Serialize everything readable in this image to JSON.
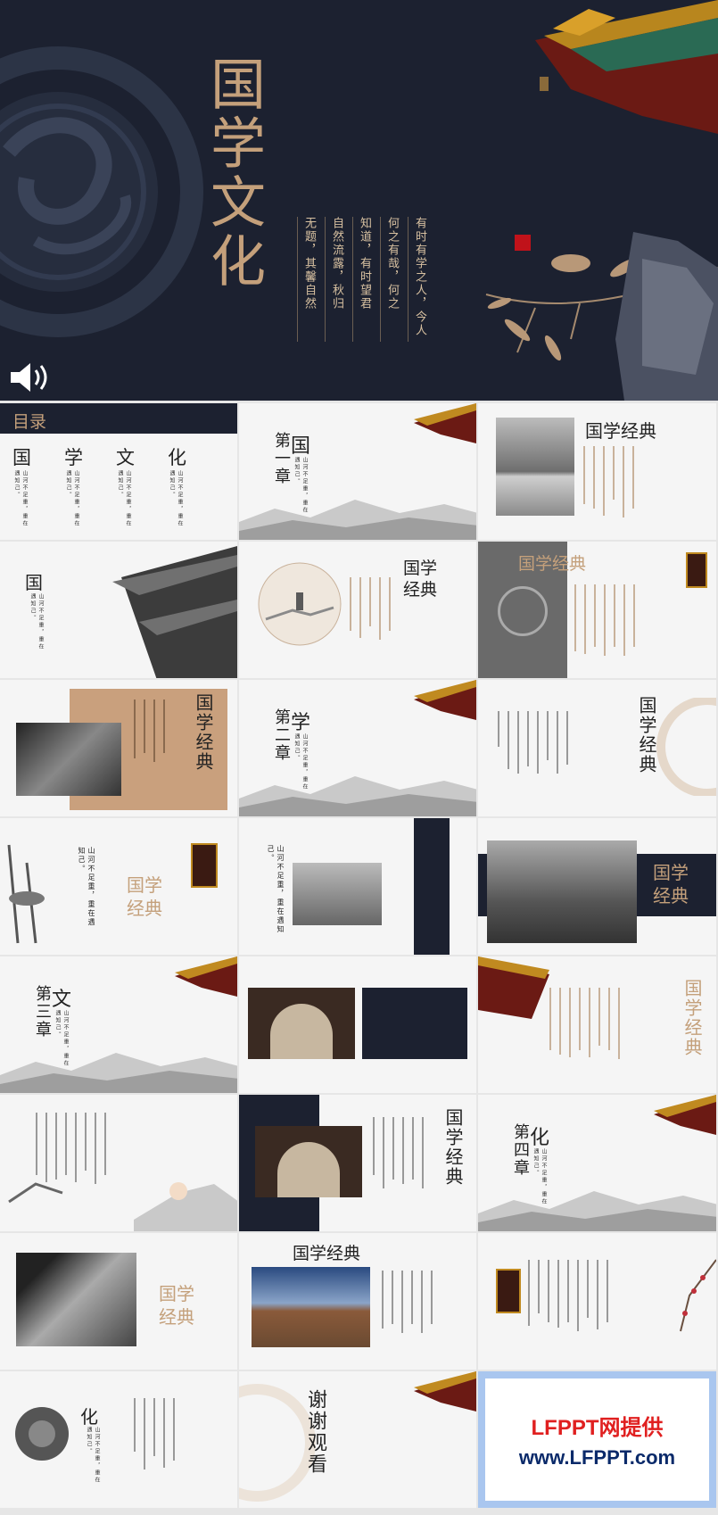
{
  "cover": {
    "title": "国学文化",
    "poem_lines": [
      "有时有学之人，今人",
      "何之有哉，何之",
      "知道，有时望君",
      "自然流露，秋归",
      "无题，其馨自然"
    ],
    "seal": "印章"
  },
  "slides": {
    "toc": {
      "header": "目录",
      "items": [
        "国",
        "学",
        "文",
        "化"
      ],
      "sub": "山河不足重，重在遇知己。"
    },
    "ch1": {
      "chapter": "第一章",
      "char": "国",
      "sub": "山河不足重，重在遇知己。"
    },
    "classic_a": {
      "title": "国学经典"
    },
    "guo": {
      "char": "国",
      "sub": "山河不足重，重在遇知己。"
    },
    "classic_b": {
      "title": "国学经典"
    },
    "classic_c": {
      "title": "国学经典"
    },
    "classic_d": {
      "title": "国学经典"
    },
    "ch2": {
      "chapter": "第二章",
      "char": "学",
      "sub": "山河不足重，重在遇知己。"
    },
    "classic_e": {
      "title": "国学经典"
    },
    "classic_f": {
      "title": "国学经典",
      "sub": "山河不足重，重在遇知己。"
    },
    "mount_text": {
      "sub": "山河不足重，重在遇知己。"
    },
    "classic_g": {
      "title": "国学经典"
    },
    "ch3": {
      "chapter": "第三章",
      "char": "文",
      "sub": "山河不足重，重在遇知己。"
    },
    "classic_h": {
      "title": "国学经典"
    },
    "classic_i": {
      "title": "国学经典"
    },
    "ch4": {
      "chapter": "第四章",
      "char": "化",
      "sub": "山河不足重，重在遇知己。"
    },
    "classic_j": {
      "title": "国学经典"
    },
    "classic_k": {
      "title": "国学经典"
    },
    "hua": {
      "char": "化",
      "sub": "山河不足重，重在遇知己。"
    },
    "thanks": {
      "title": "谢谢观看"
    },
    "logo": {
      "line1": "LFPPT网提供",
      "line2": "www.LFPPT.com"
    }
  },
  "colors": {
    "navy": "#1c2130",
    "gold": "#c39a73",
    "red": "#e02020",
    "navy_text": "#0a2a6a",
    "logo_border": "#a9c6ef"
  }
}
